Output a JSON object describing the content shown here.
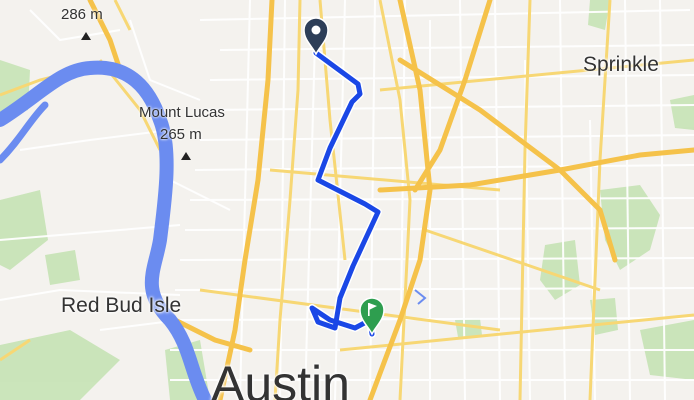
{
  "map": {
    "type": "route-map",
    "labels": {
      "top_elevation": "286 m",
      "mount_lucas": "Mount Lucas",
      "mount_lucas_elevation": "265 m",
      "sprinkle": "Sprinkle",
      "red_bud_isle": "Red Bud Isle",
      "austin": "Austin"
    },
    "route": {
      "color": "#1a47e6",
      "start_marker_color": "#2d3e58",
      "end_marker_color": "#2e9e4f",
      "end_marker_icon": "flag-icon"
    },
    "colors": {
      "land": "#f4f2ee",
      "water": "#6b8cf0",
      "park": "#c6e3b5",
      "highway": "#f5c24a",
      "major_road": "#f7d774",
      "minor_road": "#ffffff"
    }
  }
}
